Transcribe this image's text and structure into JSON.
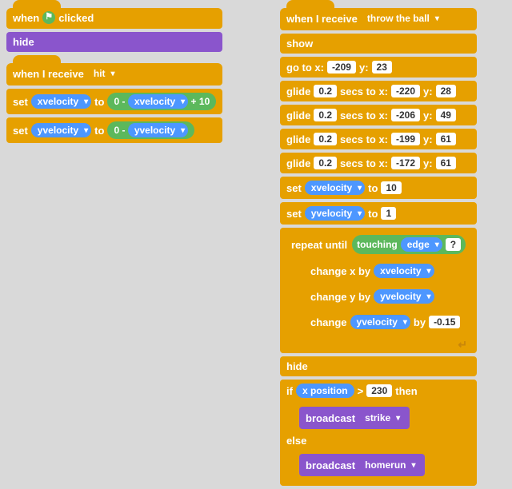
{
  "left": {
    "whenClicked": {
      "label1": "when",
      "label2": "clicked",
      "hideLabel": "hide"
    },
    "whenReceive": {
      "label1": "when I receive",
      "dropdown": "hit",
      "set1": {
        "label": "set",
        "var1": "xvelocity",
        "to": "to",
        "val1": "0",
        "minus": "-",
        "var2": "xvelocity",
        "plus": "+",
        "val2": "10"
      },
      "set2": {
        "label": "set",
        "var1": "yvelocity",
        "to": "to",
        "val1": "0",
        "minus": "-",
        "var2": "yvelocity"
      }
    }
  },
  "right": {
    "whenReceive": {
      "label": "when I receive",
      "dropdown": "throw the ball"
    },
    "show": "show",
    "goTo": {
      "label": "go to x:",
      "x": "-209",
      "ylabel": "y:",
      "y": "23"
    },
    "glide1": {
      "label": "glide",
      "secs": "0.2",
      "secsLabel": "secs to x:",
      "x": "-220",
      "ylabel": "y:",
      "y": "28"
    },
    "glide2": {
      "label": "glide",
      "secs": "0.2",
      "secsLabel": "secs to x:",
      "x": "-206",
      "ylabel": "y:",
      "y": "49"
    },
    "glide3": {
      "label": "glide",
      "secs": "0.2",
      "secsLabel": "secs to x:",
      "x": "-199",
      "ylabel": "y:",
      "y": "61"
    },
    "glide4": {
      "label": "glide",
      "secs": "0.2",
      "secsLabel": "secs to x:",
      "x": "-172",
      "ylabel": "y:",
      "y": "61"
    },
    "setX": {
      "label": "set",
      "var": "xvelocity",
      "to": "to",
      "val": "10"
    },
    "setY": {
      "label": "set",
      "var": "yvelocity",
      "to": "to",
      "val": "1"
    },
    "repeatUntil": {
      "label": "repeat until",
      "touching": "touching",
      "edge": "edge",
      "question": "?"
    },
    "changeX": {
      "label": "change x by",
      "var": "xvelocity"
    },
    "changeY": {
      "label": "change y by",
      "var": "yvelocity"
    },
    "changeYvel": {
      "label": "change",
      "var": "yvelocity",
      "by": "by",
      "val": "-0.15"
    },
    "hide": "hide",
    "ifHeader": {
      "if": "if",
      "xpos": "x position",
      "gt": ">",
      "val": "230",
      "then": "then"
    },
    "broadcast1": {
      "label": "broadcast",
      "val": "strike"
    },
    "else": "else",
    "broadcast2": {
      "label": "broadcast",
      "val": "homerun"
    }
  }
}
